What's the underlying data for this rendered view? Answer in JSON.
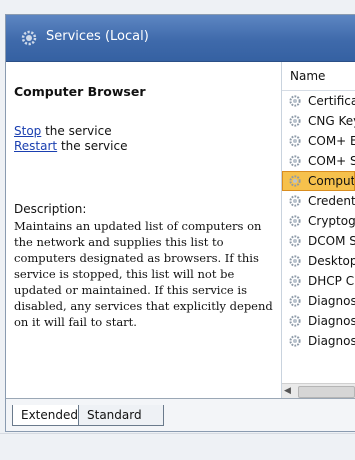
{
  "header": {
    "title": "Services (Local)"
  },
  "detail": {
    "service_name": "Computer Browser",
    "actions": [
      {
        "link": "Stop",
        "rest": " the service"
      },
      {
        "link": "Restart",
        "rest": " the service"
      }
    ],
    "description_label": "Description:",
    "description": "Maintains an updated list of computers on the network and supplies this list to computers designated as browsers. If this service is stopped, this list will not be updated or maintained. If this service is disabled, any services that explicitly depend on it will fail to start."
  },
  "list": {
    "column_header": "Name",
    "rows": [
      {
        "name": "Certifica",
        "selected": false
      },
      {
        "name": "CNG Key",
        "selected": false
      },
      {
        "name": "COM+ E",
        "selected": false
      },
      {
        "name": "COM+ S",
        "selected": false
      },
      {
        "name": "Comput",
        "selected": true
      },
      {
        "name": "Credent",
        "selected": false
      },
      {
        "name": "Cryptog",
        "selected": false
      },
      {
        "name": "DCOM S",
        "selected": false
      },
      {
        "name": "Desktop",
        "selected": false
      },
      {
        "name": "DHCP C",
        "selected": false
      },
      {
        "name": "Diagnos",
        "selected": false
      },
      {
        "name": "Diagnos",
        "selected": false
      },
      {
        "name": "Diagnos",
        "selected": false
      }
    ]
  },
  "tabs": {
    "extended": "Extended",
    "standard": "Standard"
  },
  "colors": {
    "header": "#3f6aab",
    "selection": "#f6c14c",
    "link": "#1a3fb0"
  }
}
